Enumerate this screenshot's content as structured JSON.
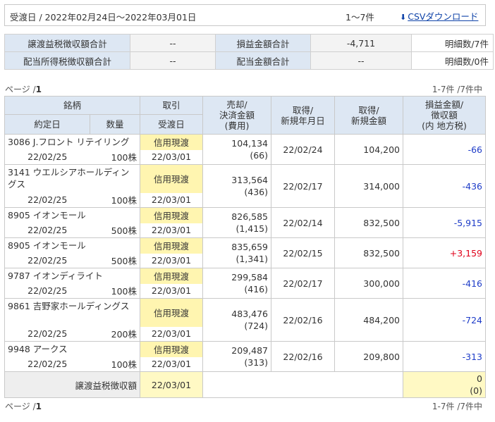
{
  "header": {
    "date_range": "受渡日 / 2022年02月24日〜2022年03月01日",
    "count": "1〜7件",
    "csv_icon": "download-icon",
    "csv_label": "CSVダウンロード"
  },
  "summary": {
    "row1": {
      "label1": "譲渡益税徴収額合計",
      "value1": "--",
      "label2": "損益金額合計",
      "value2": "-4,711",
      "detail": "明細数/7件"
    },
    "row2": {
      "label1": "配当所得税徴収額合計",
      "value1": "--",
      "label2": "配当金額合計",
      "value2": "--",
      "detail": "明細数/0件"
    }
  },
  "pager": {
    "prefix": "ページ /",
    "page": "1",
    "summary": "1-7件 /7件中"
  },
  "table": {
    "headers": {
      "stock": "銘柄",
      "trade": "取引",
      "contract_date": "約定日",
      "quantity": "数量",
      "delivery_date": "受渡日",
      "sale_amount": "売却/\n決済金額\n(費用)",
      "acquired_date": "取得/\n新規年月日",
      "acquired_amount": "取得/\n新規金額",
      "gain": "損益金額/\n徴収額\n(内 地方税)"
    },
    "rows": [
      {
        "name": "3086 J.フロント リテイリング",
        "contract": "22/02/25",
        "qty": "100株",
        "trade": "信用現渡",
        "delivery": "22/03/01",
        "sale": "104,134",
        "cost": "(66)",
        "acq_date": "22/02/24",
        "acq_amount": "104,200",
        "gain": "-66",
        "sign": "neg"
      },
      {
        "name": "3141 ウエルシアホールディングス",
        "contract": "22/02/25",
        "qty": "100株",
        "trade": "信用現渡",
        "delivery": "22/03/01",
        "sale": "313,564",
        "cost": "(436)",
        "acq_date": "22/02/17",
        "acq_amount": "314,000",
        "gain": "-436",
        "sign": "neg"
      },
      {
        "name": "8905 イオンモール",
        "contract": "22/02/25",
        "qty": "500株",
        "trade": "信用現渡",
        "delivery": "22/03/01",
        "sale": "826,585",
        "cost": "(1,415)",
        "acq_date": "22/02/14",
        "acq_amount": "832,500",
        "gain": "-5,915",
        "sign": "neg"
      },
      {
        "name": "8905 イオンモール",
        "contract": "22/02/25",
        "qty": "500株",
        "trade": "信用現渡",
        "delivery": "22/03/01",
        "sale": "835,659",
        "cost": "(1,341)",
        "acq_date": "22/02/15",
        "acq_amount": "832,500",
        "gain": "+3,159",
        "sign": "pos"
      },
      {
        "name": "9787 イオンディライト",
        "contract": "22/02/25",
        "qty": "100株",
        "trade": "信用現渡",
        "delivery": "22/03/01",
        "sale": "299,584",
        "cost": "(416)",
        "acq_date": "22/02/17",
        "acq_amount": "300,000",
        "gain": "-416",
        "sign": "neg"
      },
      {
        "name": "9861 吉野家ホールディングス",
        "contract": "22/02/25",
        "qty": "200株",
        "trade": "信用現渡",
        "delivery": "22/03/01",
        "sale": "483,476",
        "cost": "(724)",
        "acq_date": "22/02/16",
        "acq_amount": "484,200",
        "gain": "-724",
        "sign": "neg"
      },
      {
        "name": "9948 アークス",
        "contract": "22/02/25",
        "qty": "100株",
        "trade": "信用現渡",
        "delivery": "22/03/01",
        "sale": "209,487",
        "cost": "(313)",
        "acq_date": "22/02/16",
        "acq_amount": "209,800",
        "gain": "-313",
        "sign": "neg"
      }
    ],
    "footer": {
      "label": "譲渡益税徴収額",
      "date": "22/03/01",
      "total": "0",
      "total_local": "(0)"
    }
  },
  "colors": {
    "header_bg": "#dde7f3",
    "tag_bg": "#fff5b0",
    "negative": "#1e3cc8",
    "positive": "#e0001a",
    "link": "#0f43a8"
  }
}
